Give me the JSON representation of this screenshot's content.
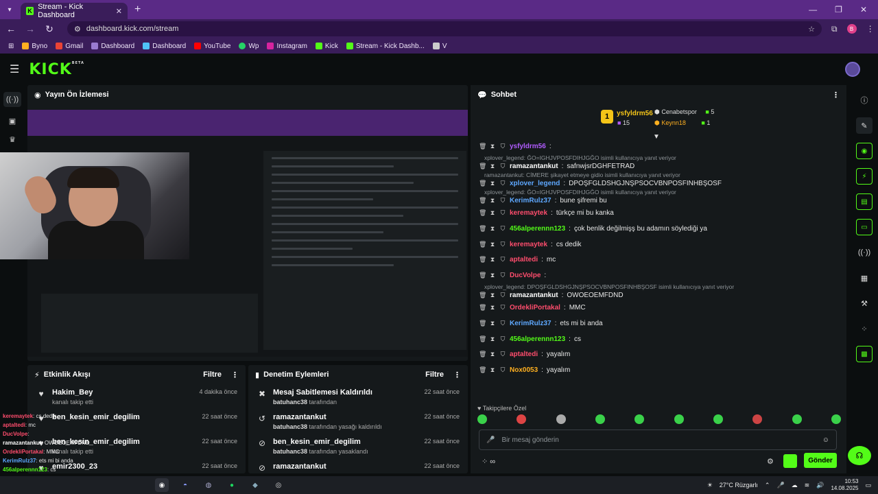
{
  "browser": {
    "tab_title": "Stream - Kick Dashboard",
    "url": "dashboard.kick.com/stream",
    "bookmarks": [
      "Byno",
      "Gmail",
      "Dashboard",
      "Dashboard",
      "YouTube",
      "Wp",
      "Instagram",
      "Kick",
      "Stream - Kick Dashb...",
      "V"
    ],
    "profile_initial": "B"
  },
  "header": {
    "logo": "KICK",
    "logo_beta": "BETA"
  },
  "preview": {
    "title": "Yayın Ön İzlemesi"
  },
  "activity": {
    "title": "Etkinlik Akışı",
    "filter": "Filtre",
    "items": [
      {
        "name": "Hakim_Bey",
        "sub": "kanalı takip etti",
        "time": "4 dakika önce"
      },
      {
        "name": "ben_kesin_emir_degilim",
        "sub": "",
        "time": "22 saat önce"
      },
      {
        "name": "ben_kesin_emir_degilim",
        "sub": "kanalı takip etti",
        "time": "22 saat önce"
      },
      {
        "name": "emir2300_23",
        "sub": "",
        "time": "22 saat önce"
      }
    ]
  },
  "moderation": {
    "title": "Denetim Eylemleri",
    "filter": "Filtre",
    "items": [
      {
        "action": "Mesaj Sabitlemesi Kaldırıldı",
        "by": "batuhanc38",
        "suffix": "tarafından",
        "time": "22 saat önce"
      },
      {
        "action": "ramazantankut",
        "by": "batuhanc38",
        "suffix": "tarafından yasağı kaldırıldı",
        "time": "22 saat önce"
      },
      {
        "action": "ben_kesin_emir_degilim",
        "by": "batuhanc38",
        "suffix": "tarafından yasaklandı",
        "time": "22 saat önce"
      },
      {
        "action": "ramazantankut",
        "by": "",
        "suffix": "",
        "time": "22 saat önce"
      }
    ]
  },
  "overlay_chat": [
    {
      "user": "keremaytek",
      "text": "cs dedik",
      "color": "#ff4d6d"
    },
    {
      "user": "aptaltedi",
      "text": "mc",
      "color": "#ff4d6d"
    },
    {
      "user": "DucVolpe",
      "text": "",
      "color": "#ff4d6d"
    },
    {
      "user": "ramazantankut",
      "text": "OWOEOEMFDND",
      "color": "#ffffff"
    },
    {
      "user": "OrdekliPortakal",
      "text": "MMC",
      "color": "#ff4d6d"
    },
    {
      "user": "KerimRulz37",
      "text": "ets mi bi anda",
      "color": "#5ea8ff"
    },
    {
      "user": "456alperennn123",
      "text": "cs",
      "color": "#53fc18"
    },
    {
      "user": "aptaltedi",
      "text": "yayalım",
      "color": "#ff4d6d"
    },
    {
      "user": "Nox0053",
      "text": "yayalım",
      "color": "#ffb020"
    }
  ],
  "chat": {
    "title": "Sohbet",
    "leader": {
      "name": "ysfyldrm56",
      "count": "15",
      "rank": "1"
    },
    "leaders_side": [
      {
        "name": "Cenabetspor",
        "count": "5",
        "color": "#ddd"
      },
      {
        "name": "Keynn18",
        "count": "1",
        "color": "#ffb020"
      }
    ],
    "messages": [
      {
        "reply": "",
        "user": "ysfyldrm56",
        "text": "",
        "color": "#b15cff"
      },
      {
        "reply": "xplover_legend: ĞO=IGHJVPOSFDIHJGĞO isimli kullanıcıya yanıt veriyor",
        "user": "ramazantankut",
        "text": "safnwjsrDGHFETRAD",
        "color": "#ffffff"
      },
      {
        "reply": "ramazantankut: CİMERE şikayet etmeye gidio isimli kullanıcıya yanıt veriyor",
        "user": "xplover_legend",
        "text": "DPOŞFGLDSHGJNŞPSOCVBNPOSFINHBŞOSF",
        "color": "#5ea8ff"
      },
      {
        "reply": "xplover_legend: ĞO=IGHJVPOSFDIHJGĞO isimli kullanıcıya yanıt veriyor",
        "user": "KerimRulz37",
        "text": "bune şifremi bu",
        "color": "#5ea8ff"
      },
      {
        "reply": "",
        "user": "keremaytek",
        "text": "türkçe mi bu kanka",
        "color": "#ff4d6d"
      },
      {
        "reply": "",
        "user": "456alperennn123",
        "text": "çok benlik değilmişş bu adamın söylediği ya",
        "color": "#53fc18"
      },
      {
        "reply": "",
        "user": "keremaytek",
        "text": "cs dedik",
        "color": "#ff4d6d"
      },
      {
        "reply": "",
        "user": "aptaltedi",
        "text": "mc",
        "color": "#ff4d6d"
      },
      {
        "reply": "",
        "user": "DucVolpe",
        "text": "",
        "color": "#ff4d6d"
      },
      {
        "reply": "xplover_legend: DPOŞFGLDSHGJNŞPSOCVBNPOSFINHBŞOSF isimli kullanıcıya yanıt veriyor",
        "user": "ramazantankut",
        "text": "OWOEOEMFDND",
        "color": "#ffffff"
      },
      {
        "reply": "",
        "user": "OrdekliPortakal",
        "text": "MMC",
        "color": "#ff4d6d"
      },
      {
        "reply": "",
        "user": "KerimRulz37",
        "text": "ets mi bi anda",
        "color": "#5ea8ff"
      },
      {
        "reply": "",
        "user": "456alperennn123",
        "text": "cs",
        "color": "#53fc18"
      },
      {
        "reply": "",
        "user": "aptaltedi",
        "text": "yayalım",
        "color": "#ff4d6d"
      },
      {
        "reply": "",
        "user": "Nox0053",
        "text": "yayalım",
        "color": "#ffb020"
      }
    ],
    "emotes_label": "Takipçilere Özel",
    "input_placeholder": "Bir mesaj gönderin",
    "send_label": "Gönder"
  },
  "taskbar": {
    "weather": "27°C Rüzgarlı",
    "time": "10:53",
    "date": "14.08.2025"
  }
}
